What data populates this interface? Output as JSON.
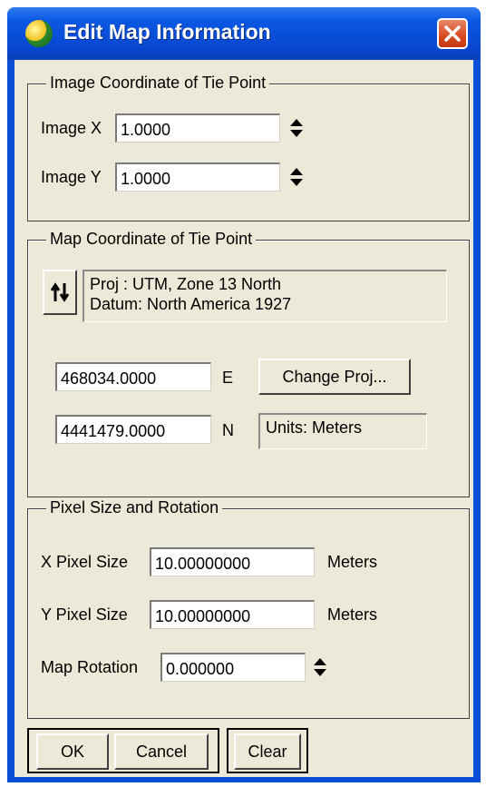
{
  "window": {
    "title": "Edit Map Information"
  },
  "image_group": {
    "label": "Image Coordinate of Tie Point",
    "x_label": "Image X",
    "x_value": "1.0000",
    "y_label": "Image Y",
    "y_value": "1.0000"
  },
  "map_group": {
    "label": "Map Coordinate of Tie Point",
    "proj_line1": "Proj : UTM, Zone 13 North",
    "proj_line2": "Datum: North America 1927",
    "easting_value": "468034.0000",
    "easting_unit": "E",
    "northing_value": "4441479.0000",
    "northing_unit": "N",
    "change_proj_label": "Change Proj...",
    "units_text": "Units: Meters"
  },
  "pixel_group": {
    "label": "Pixel Size and Rotation",
    "x_pixel_label": "X Pixel Size",
    "x_pixel_value": "10.00000000",
    "x_pixel_unit": "Meters",
    "y_pixel_label": "Y Pixel Size",
    "y_pixel_value": "10.00000000",
    "y_pixel_unit": "Meters",
    "rotation_label": "Map Rotation",
    "rotation_value": "0.000000"
  },
  "buttons": {
    "ok": "OK",
    "cancel": "Cancel",
    "clear": "Clear"
  }
}
